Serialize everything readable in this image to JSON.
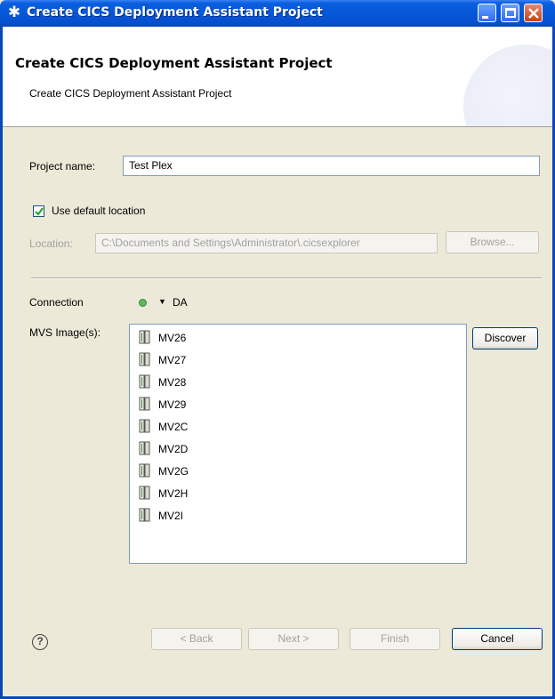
{
  "window": {
    "title": "Create CICS Deployment Assistant Project",
    "icon": "star-icon"
  },
  "banner": {
    "title": "Create CICS Deployment Assistant Project",
    "description": "Create CICS Deployment Assistant Project"
  },
  "form": {
    "project_name_label": "Project name:",
    "project_name_value": "Test Plex",
    "use_default_location_label": "Use default location",
    "use_default_location_checked": true,
    "location_label": "Location:",
    "location_value": "C:\\Documents and Settings\\Administrator\\.cicsexplorer",
    "browse_label": "Browse...",
    "connection_label": "Connection",
    "connection_status_color": "#5cb85c",
    "connection_value": "DA",
    "mvs_images_label": "MVS Image(s):",
    "discover_label": "Discover",
    "mvs_images": [
      "MV26",
      "MV27",
      "MV28",
      "MV29",
      "MV2C",
      "MV2D",
      "MV2G",
      "MV2H",
      "MV2I"
    ]
  },
  "footer": {
    "help_icon": "help-icon",
    "back_label": "< Back",
    "next_label": "Next >",
    "finish_label": "Finish",
    "cancel_label": "Cancel"
  }
}
